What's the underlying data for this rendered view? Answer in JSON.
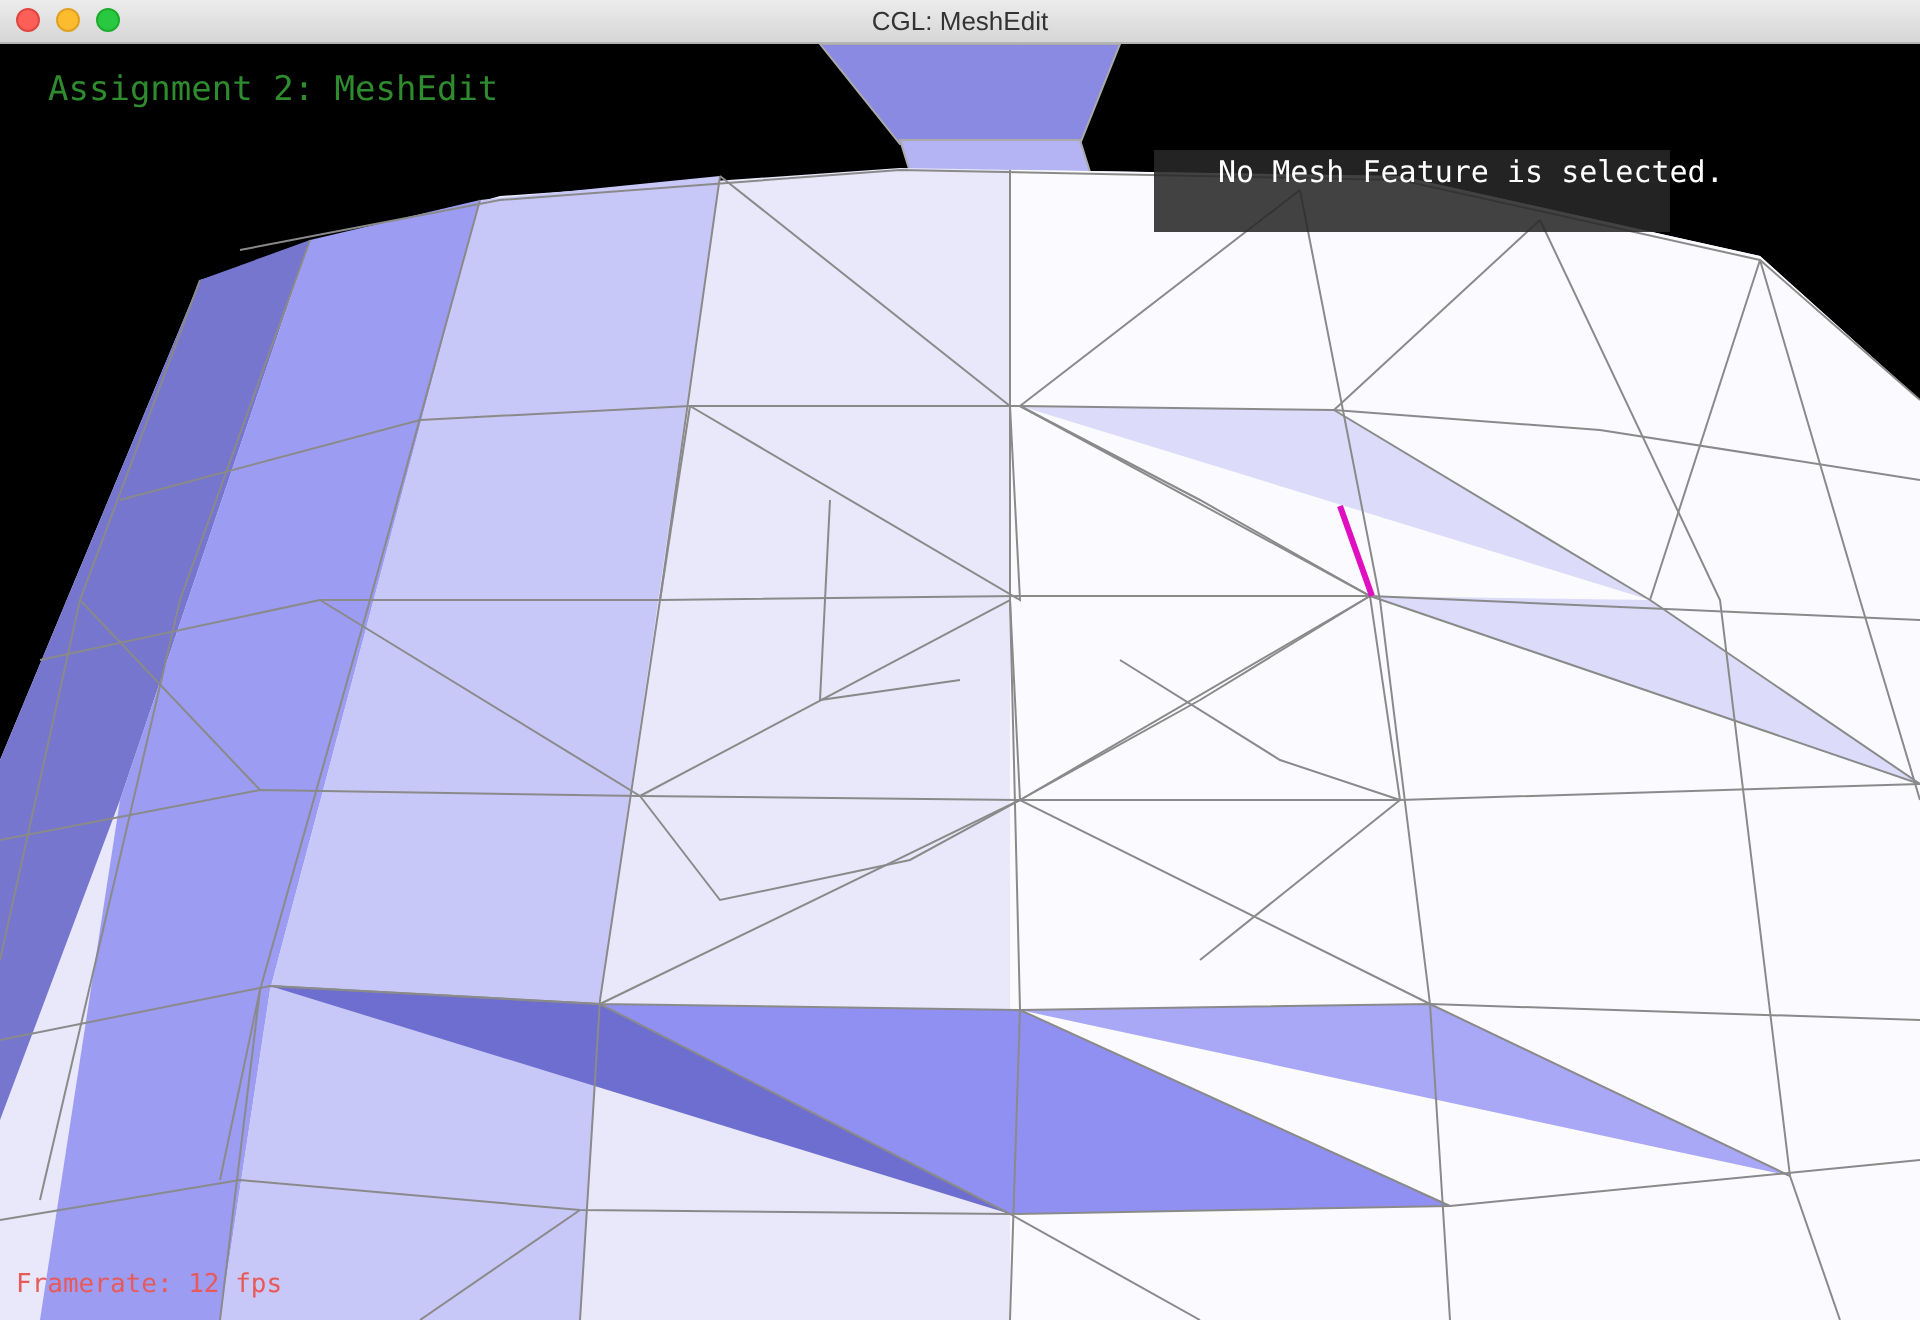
{
  "window": {
    "title": "CGL: MeshEdit"
  },
  "viewport": {
    "heading": "Assignment 2: MeshEdit",
    "status_message": "No Mesh Feature is selected.",
    "framerate": "Framerate: 12 fps"
  }
}
